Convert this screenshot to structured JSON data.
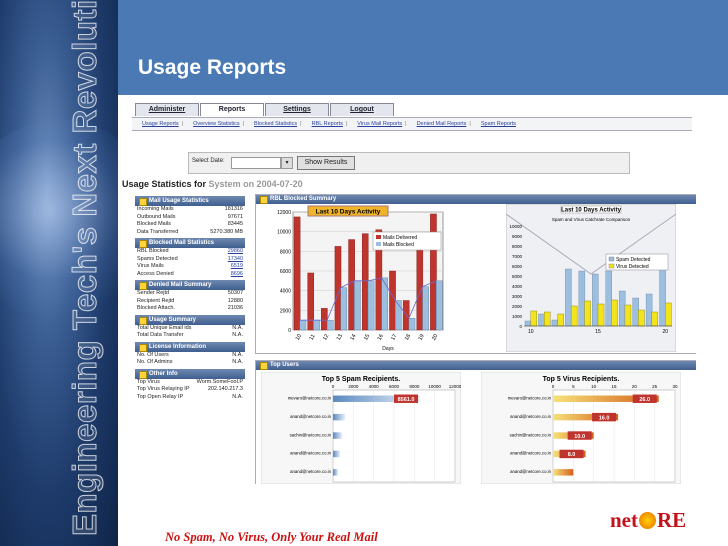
{
  "sidebar": {
    "vertical_text": "Engineering Tech's Next Revolution"
  },
  "header": {
    "title": "Usage Reports"
  },
  "footer": {
    "tagline": "No Spam, No Virus, Only Your Real Mail",
    "logo_pre": "net",
    "logo_post": "RE"
  },
  "tabs": [
    "Administer",
    "Reports",
    "Settings",
    "Logout"
  ],
  "active_tab": "Reports",
  "subnav": [
    "Usage Reports",
    "Overview Statistics",
    "Blocked Statistics",
    "RBL Reports",
    "Virus Mail Reports",
    "Denied Mail Reports",
    "Spam Reports"
  ],
  "date_select": {
    "label": "Select Date:",
    "button": "Show Results"
  },
  "stats_heading": {
    "prefix": "Usage Statistics for",
    "system": "System on 2004-07-20"
  },
  "sections": {
    "mail_usage": {
      "title": "Mail Usage Statistics",
      "rows": [
        {
          "k": "Incoming Mails",
          "v": "181316"
        },
        {
          "k": "Outbound Mails",
          "v": "97671"
        },
        {
          "k": "Blocked Mails",
          "v": "83445"
        },
        {
          "k": "Data Transferred",
          "v": "5270.380 MB"
        }
      ]
    },
    "blocked_mail": {
      "title": "Blocked Mail Statistics",
      "rows": [
        {
          "k": "RBL Blocked",
          "v": "29860"
        },
        {
          "k": "Spams Detected",
          "v": "17340"
        },
        {
          "k": "Virus Mails",
          "v": "6519"
        },
        {
          "k": "Access Denied",
          "v": "8696"
        }
      ]
    },
    "denied_mail": {
      "title": "Denied Mail Summary",
      "rows": [
        {
          "k": "Sender Rejtd",
          "v": "50307"
        },
        {
          "k": "Recipient Rejtd",
          "v": "12880"
        },
        {
          "k": "Blocked Attach.",
          "v": "21036"
        }
      ]
    },
    "usage_summary": {
      "title": "Usage Summary",
      "rows": [
        {
          "k": "Total Unique Email ids",
          "v": "N.A."
        },
        {
          "k": "Total Data Transfer",
          "v": "N.A."
        }
      ]
    },
    "license": {
      "title": "License Information",
      "rows": [
        {
          "k": "No. Of Users",
          "v": "N.A."
        },
        {
          "k": "No. Of Admins",
          "v": "N.A."
        }
      ]
    },
    "other": {
      "title": "Other Info",
      "rows": [
        {
          "k": "Top Virus",
          "v": "Worm.SomeFool.P"
        },
        {
          "k": "Top Virus Relaying IP",
          "v": "202.140.217.3"
        },
        {
          "k": "Top Open Relay IP",
          "v": "N.A."
        }
      ]
    }
  },
  "rbl_panel": {
    "title": "RBL Blocked Summary"
  },
  "top_users_panel": {
    "title": "Top Users"
  },
  "chart_data": [
    {
      "type": "bar",
      "title": "Last 10 Days Activity",
      "categories": [
        "10",
        "11",
        "12",
        "13",
        "14",
        "15",
        "16",
        "17",
        "18",
        "19",
        "20"
      ],
      "xlabel": "Days",
      "ylim": [
        0,
        120000
      ],
      "yticks": [
        "0",
        "2000",
        "4000",
        "6000",
        "8000",
        "10000",
        "12000"
      ],
      "series": [
        {
          "name": "Mails Delivered",
          "values": [
            115000,
            58000,
            22000,
            85000,
            92000,
            98000,
            102000,
            60000,
            30000,
            95000,
            118000
          ]
        },
        {
          "name": "Mails Blocked",
          "values": [
            10000,
            10000,
            10000,
            43000,
            50000,
            50000,
            53000,
            30000,
            12000,
            44000,
            50000
          ]
        }
      ],
      "colors": {
        "delivered": "#c0342e",
        "blocked": "#9cbfe0"
      }
    },
    {
      "type": "bar",
      "title": "Last 10 Days Activity",
      "subtitle": "Spam and Virus Catchrate Comparison",
      "x": [
        "10",
        "15",
        "20"
      ],
      "ylim": [
        0,
        10000
      ],
      "yticks": [
        "0",
        "1000",
        "2000",
        "3000",
        "4000",
        "5000",
        "6000",
        "7000",
        "8000",
        "9000",
        "10000"
      ],
      "series": [
        {
          "name": "Spam Detected",
          "values": [
            500,
            1200,
            600,
            5700,
            5500,
            5200,
            5500,
            3500,
            2800,
            3200,
            6200
          ]
        },
        {
          "name": "Virus Detected",
          "values": [
            1500,
            1400,
            1200,
            2000,
            2500,
            2200,
            2600,
            2100,
            1600,
            1400,
            2300
          ]
        }
      ],
      "colors": {
        "spam": "#9cbfe0",
        "virus": "#f2e31f"
      }
    },
    {
      "type": "bar",
      "title": "Top 5 Spam Recipients.",
      "xticks": [
        "0",
        "2000",
        "4000",
        "6000",
        "8000",
        "10000",
        "12000"
      ],
      "categories": [
        "mevaro@netcore.co.in",
        "anand@netcore.co.in",
        "sachin@netcore.co.in",
        "anand@netcore.co.in",
        "anand@netcore.co.in"
      ],
      "values": [
        8561.0,
        1200,
        900,
        700,
        500
      ],
      "xlim": [
        0,
        12000
      ],
      "labels": [
        "8561.0"
      ]
    },
    {
      "type": "bar",
      "title": "Top 5 Virus Recipients.",
      "xticks": [
        "0",
        "5",
        "10",
        "15",
        "20",
        "25",
        "30"
      ],
      "categories": [
        "mevaro@netcore.co.in",
        "anand@netcore.co.in",
        "sachin@netcore.co.in",
        "anand@netcore.co.in",
        "anand@netcore.co.in"
      ],
      "values": [
        26.0,
        16.0,
        10.0,
        8.0,
        5.0
      ],
      "xlim": [
        0,
        30
      ],
      "labels": [
        "26.0",
        "16.0",
        "10.0",
        "8.0"
      ]
    }
  ]
}
